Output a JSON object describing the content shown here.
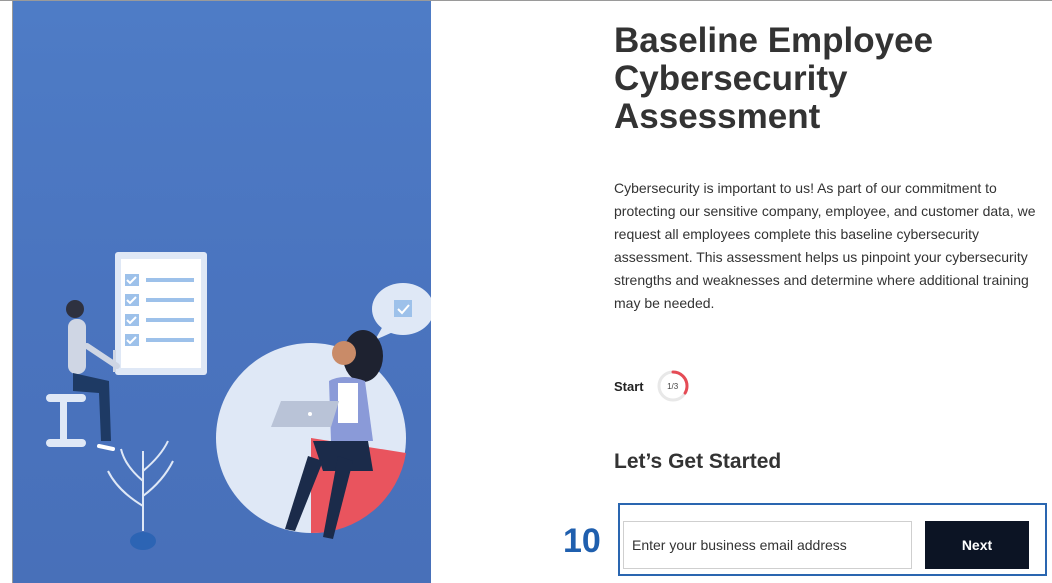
{
  "assessment": {
    "title": "Baseline Employee Cybersecurity Assessment",
    "intro": "Cybersecurity is important to us! As part of our commitment to protecting our sensitive company, employee, and customer data, we request all employees complete this baseline cybersecurity assessment. This assessment helps us pinpoint your cybersecurity strengths and weaknesses and determine where additional training may be needed."
  },
  "progress": {
    "label": "Start",
    "indicator": "1/3",
    "current_step": 1,
    "total_steps": 3
  },
  "form": {
    "heading": "Let’s Get Started",
    "email_placeholder": "Enter your business email address",
    "email_value": "",
    "next_label": "Next"
  },
  "annotation": {
    "step_number": "10"
  },
  "colors": {
    "hero_background": "#4a74bf",
    "button_background": "#0c1424",
    "progress_ring": "#e54b55",
    "annotation_blue": "#1f5fae"
  }
}
